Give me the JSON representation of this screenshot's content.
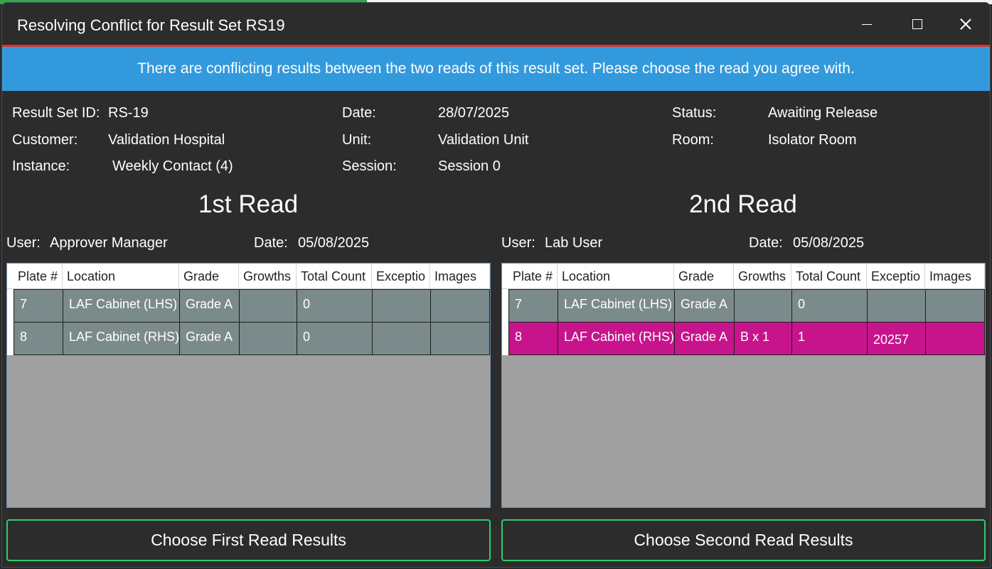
{
  "window": {
    "title": "Resolving Conflict for Result Set RS19",
    "minimize_icon": "minimize-icon",
    "maximize_icon": "maximize-icon",
    "close_icon": "close-icon"
  },
  "banner": {
    "text": "There are conflicting results between the two reads of this result set. Please choose the read you agree with.",
    "color": "#3399dd"
  },
  "info": {
    "result_set_id_label": "Result Set ID:",
    "result_set_id": "RS-19",
    "customer_label": "Customer:",
    "customer": "Validation Hospital",
    "instance_label": "Instance:",
    "instance": "Weekly Contact (4)",
    "date_label": "Date:",
    "date": "28/07/2025",
    "unit_label": "Unit:",
    "unit": "Validation Unit",
    "session_label": "Session:",
    "session": "Session 0",
    "status_label": "Status:",
    "status": "Awaiting Release",
    "room_label": "Room:",
    "room": "Isolator Room"
  },
  "columns": [
    "Plate #",
    "Location",
    "Grade",
    "Growths",
    "Total Count",
    "Exceptio",
    "Images"
  ],
  "read1": {
    "title": "1st Read",
    "user_label": "User:",
    "user": "Approver Manager",
    "date_label": "Date:",
    "date": "05/08/2025",
    "rows": [
      {
        "plate": "7",
        "location": "LAF Cabinet (LHS)",
        "grade": "Grade A",
        "growths": "",
        "total": "0",
        "exception": "",
        "images": ""
      },
      {
        "plate": "8",
        "location": "LAF Cabinet (RHS)",
        "grade": "Grade A",
        "growths": "",
        "total": "0",
        "exception": "",
        "images": ""
      }
    ],
    "button": "Choose First Read Results"
  },
  "read2": {
    "title": "2nd Read",
    "user_label": "User:",
    "user": "Lab User",
    "date_label": "Date:",
    "date": "05/08/2025",
    "rows": [
      {
        "plate": "7",
        "location": "LAF Cabinet (LHS)",
        "grade": "Grade A",
        "growths": "",
        "total": "0",
        "exception": "",
        "images": ""
      },
      {
        "plate": "8",
        "location": "LAF Cabinet (RHS)",
        "grade": "Grade A",
        "growths": "B x 1",
        "total": "1",
        "exception": "20257",
        "images": ""
      }
    ],
    "button": "Choose Second Read Results"
  },
  "colors": {
    "row_normal": "#7b8a8b",
    "row_conflict": "#c8148c",
    "button_border": "#2ecc71"
  }
}
